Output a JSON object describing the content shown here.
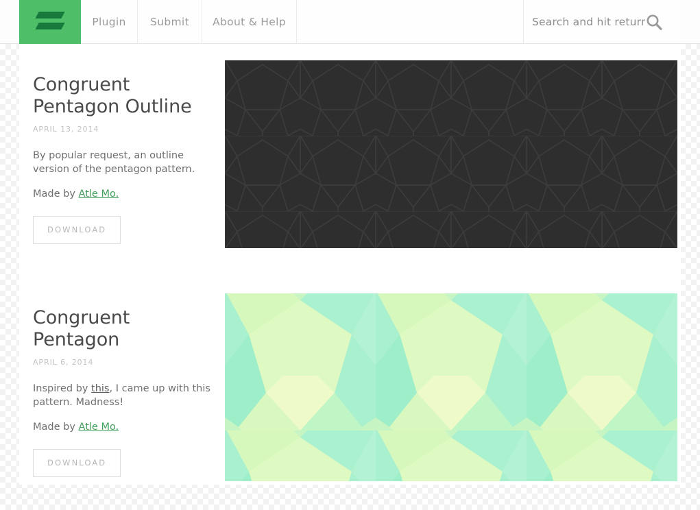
{
  "site": {
    "logo_name": "subtle-patterns-logo",
    "accent_green": "#4ebe68",
    "logo_bar_color": "#157a3b",
    "page_background": "transparency-checkerboard"
  },
  "header": {
    "nav": [
      {
        "label": "Plugin",
        "name": "nav-plugin"
      },
      {
        "label": "Submit",
        "name": "nav-submit"
      },
      {
        "label": "About & Help",
        "name": "nav-about"
      }
    ],
    "search": {
      "placeholder": "Search and hit return",
      "value": "",
      "icon": "search-icon"
    }
  },
  "posts": [
    {
      "title": "Congruent Pentagon Outline",
      "date": "APRIL 13, 2014",
      "description": "By popular request, an outline version of the pentagon pattern.",
      "made_by_prefix": "Made by ",
      "author": "Atle Mo.",
      "download_label": "DOWNLOAD",
      "preview": {
        "name": "congruent-pentagon-outline-preview",
        "type": "pentagon-outline",
        "background": "#2e2e2e",
        "line_color": "#3b3b3b"
      }
    },
    {
      "title": "Congruent Pentagon",
      "date": "APRIL 6, 2014",
      "description_before": "Inspired by ",
      "description_link": "this",
      "description_after": ", I came up with this pattern. Madness!",
      "made_by_prefix": "Made by ",
      "author": "Atle Mo.",
      "download_label": "DOWNLOAD",
      "preview": {
        "name": "congruent-pentagon-preview",
        "type": "pentagon-filled",
        "colors": [
          "#eafac6",
          "#d2f7bd",
          "#a9f0cf",
          "#c3f6c4",
          "#b6f3d6",
          "#e0fbc9",
          "#95edc6"
        ]
      }
    }
  ]
}
